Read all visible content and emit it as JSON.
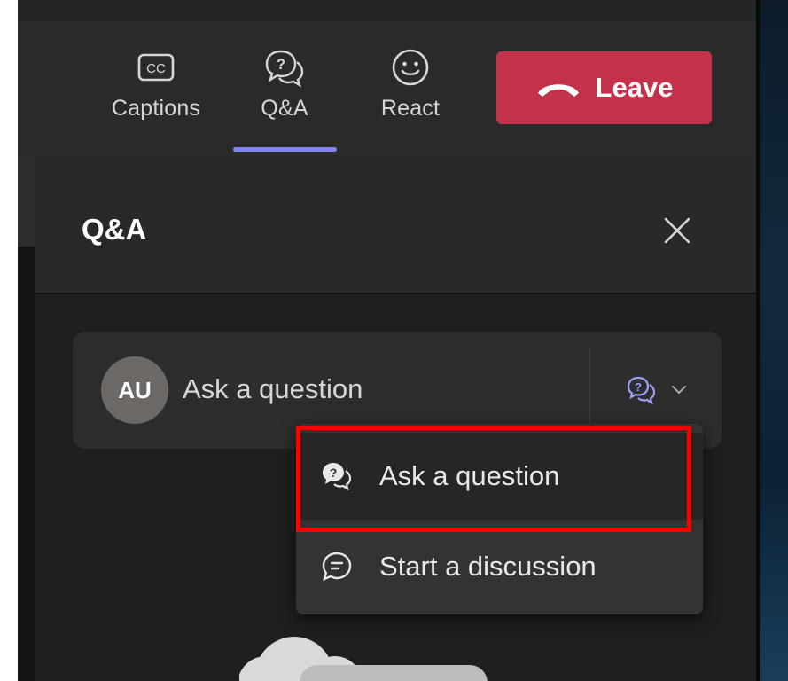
{
  "toolbar": {
    "captions_label": "Captions",
    "qa_label": "Q&A",
    "react_label": "React",
    "leave_label": "Leave",
    "captions_icon_text": "CC",
    "accent_color": "#7f85f5",
    "leave_color": "#c4314b"
  },
  "panel": {
    "title": "Q&A"
  },
  "compose": {
    "avatar_initials": "AU",
    "placeholder": "Ask a question"
  },
  "type_menu": {
    "items": [
      {
        "label": "Ask a question",
        "icon": "question-bubble-icon",
        "selected": true
      },
      {
        "label": "Start a discussion",
        "icon": "discussion-bubble-icon",
        "selected": false
      }
    ]
  },
  "annotation": {
    "highlight_color": "#ff0000"
  }
}
